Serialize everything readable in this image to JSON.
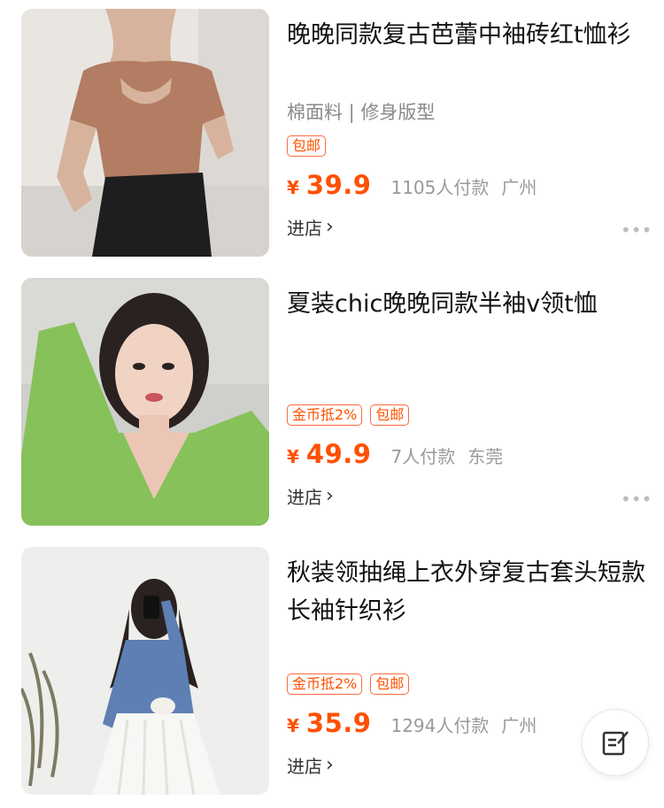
{
  "products": [
    {
      "title": "晚晚同款复古芭蕾中袖砖红t恤衫",
      "subtitle": "棉面料 | 修身版型",
      "tags": [
        "包邮"
      ],
      "currency": "¥",
      "price": "39.9",
      "sales": "1105人付款",
      "location": "广州",
      "shop_link": "进店",
      "thumbnail_icon": "product-photo-brown-tee"
    },
    {
      "title": "夏装chic晚晚同款半袖v领t恤",
      "subtitle": "",
      "tags": [
        "金币抵2%",
        "包邮"
      ],
      "currency": "¥",
      "price": "49.9",
      "sales": "7人付款",
      "location": "东莞",
      "shop_link": "进店",
      "thumbnail_icon": "product-photo-green-top"
    },
    {
      "title": "秋装领抽绳上衣外穿复古套头短款长袖针织衫",
      "subtitle": "",
      "tags": [
        "金币抵2%",
        "包邮"
      ],
      "currency": "¥",
      "price": "35.9",
      "sales": "1294人付款",
      "location": "广州",
      "shop_link": "进店",
      "thumbnail_icon": "product-photo-blue-cardigan"
    }
  ],
  "more_icon": "ellipsis-icon",
  "fab_icon": "edit-note-icon",
  "colors": {
    "accent": "#ff5000",
    "text": "#111111",
    "muted": "#9a9a9a"
  }
}
